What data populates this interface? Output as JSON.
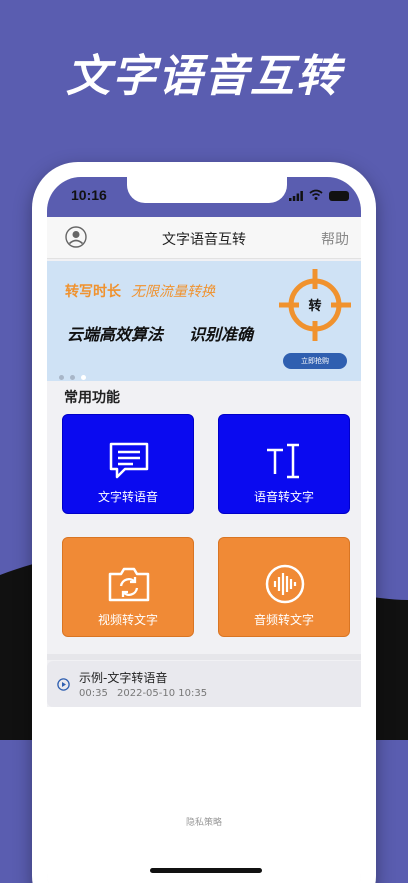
{
  "promo": {
    "title": "文字语音互转"
  },
  "status_bar": {
    "time": "10:16"
  },
  "nav": {
    "title": "文字语音互转",
    "help": "帮助"
  },
  "banner": {
    "line1_a": "转写时长",
    "line1_b": "无限流量转换",
    "line2_a": "云端高效算法",
    "line2_b": "识别准确",
    "target_char": "转",
    "buy_button": "立即抢购",
    "carousel_active_index": 2,
    "carousel_count": 3
  },
  "functions": {
    "section_title": "常用功能",
    "items": [
      {
        "label": "文字转语音",
        "icon": "chat-text-icon",
        "color": "#0a0af0"
      },
      {
        "label": "语音转文字",
        "icon": "text-cursor-icon",
        "color": "#0a0af0"
      },
      {
        "label": "视频转文字",
        "icon": "camera-rotate-icon",
        "color": "#f08a36"
      },
      {
        "label": "音频转文字",
        "icon": "sound-wave-icon",
        "color": "#f08a36"
      }
    ]
  },
  "example": {
    "title": "示例-文字转语音",
    "duration": "00:35",
    "date": "2022-05-10 10:35"
  },
  "footer": {
    "privacy": "隐私策略"
  },
  "colors": {
    "background": "#5a5db0",
    "accent_orange": "#f0922e",
    "tile_blue": "#0a0af0",
    "tile_orange": "#f08a36",
    "banner_bg": "#cfe2f5"
  }
}
